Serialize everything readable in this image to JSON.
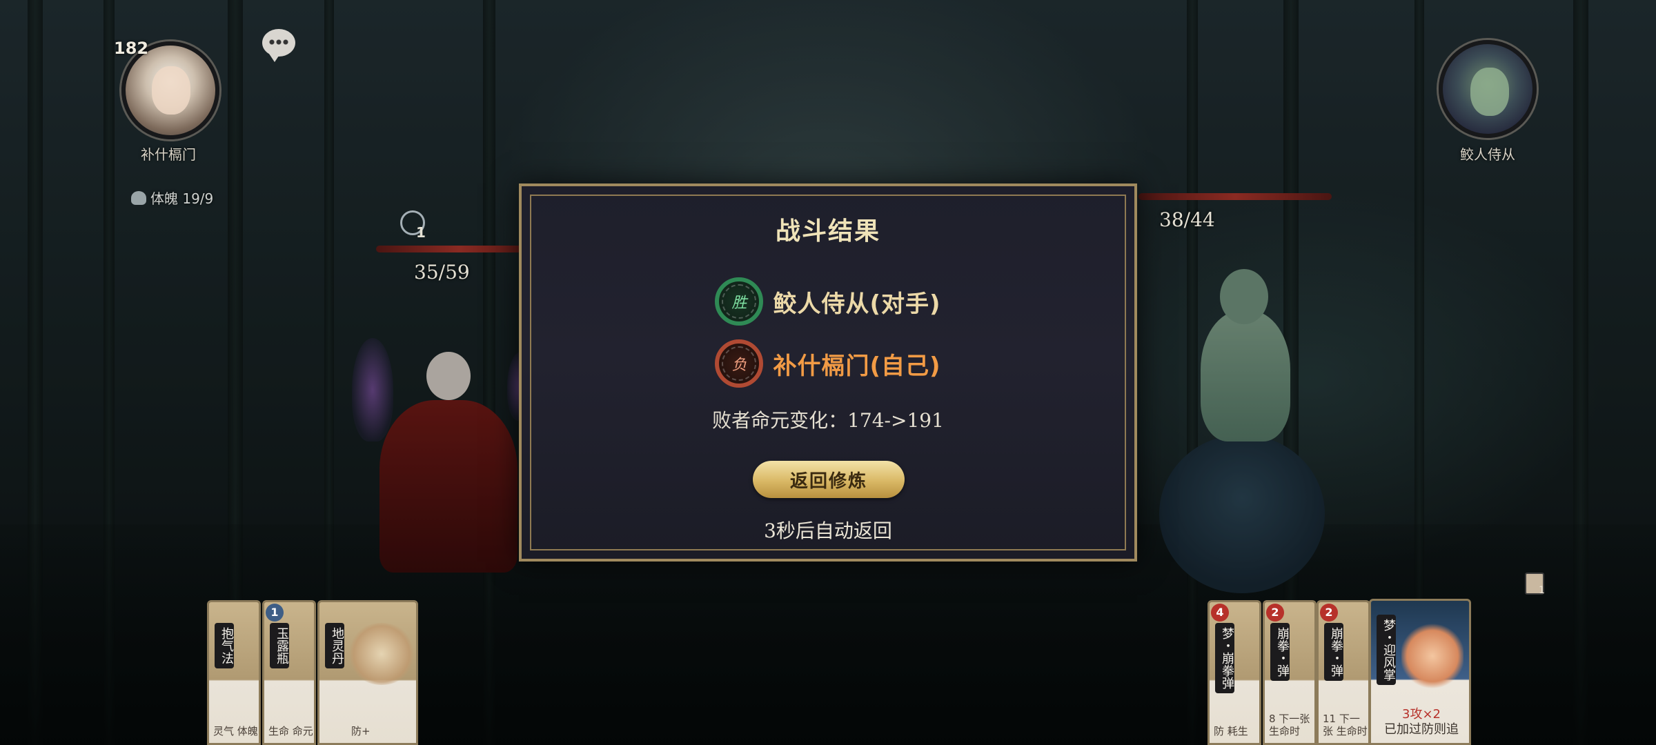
{
  "player": {
    "name": "补什槅门",
    "level": "182",
    "stat_label": "体魄 19/9",
    "hp": "35/59",
    "shield": "1"
  },
  "opponent": {
    "name": "鲛人侍从",
    "hp": "38/44"
  },
  "result_modal": {
    "title": "战斗结果",
    "winner_badge": "胜",
    "winner_name": "鲛人侍从(对手)",
    "loser_badge": "负",
    "loser_name": "补什槅门(自己)",
    "change_text": "败者命元变化：174->191",
    "return_button": "返回修炼",
    "auto_return_text": "3秒后自动返回"
  },
  "player_cards": [
    {
      "title": "抱气法",
      "cost": "",
      "text": "灵气 体魄"
    },
    {
      "title": "玉露瓶",
      "cost": "1",
      "text": "生命 命元"
    },
    {
      "title": "地灵丹",
      "cost": "",
      "text": "防+"
    }
  ],
  "opponent_cards": [
    {
      "title": "梦・崩拳弹",
      "cost": "4",
      "text": "防 耗生"
    },
    {
      "title": "崩拳・弹",
      "cost": "2",
      "text": "8 下一张 生命时"
    },
    {
      "title": "崩拳・弹",
      "cost": "2",
      "text": "11 下一张 生命时"
    }
  ],
  "opponent_main_card": {
    "title": "梦・迎风掌",
    "attack_text": "3攻×2",
    "effect_text": "已加过防则追"
  },
  "misc": {
    "small_counter": "1"
  }
}
